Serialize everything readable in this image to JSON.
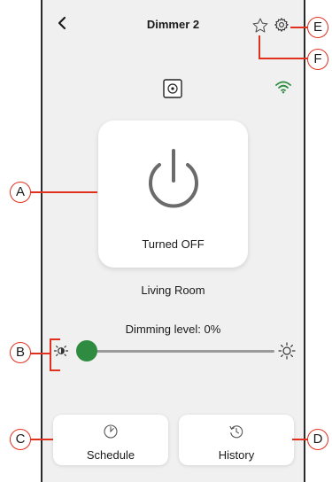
{
  "header": {
    "back_icon": "chevron-left",
    "title": "Dimmer 2",
    "favorite_icon": "star-outline",
    "settings_icon": "gear"
  },
  "device": {
    "icon": "device-module",
    "connection_icon": "wifi",
    "connection_color": "#2e8b3f"
  },
  "power": {
    "icon": "power",
    "status": "Turned OFF"
  },
  "room": "Living Room",
  "dimming": {
    "label": "Dimming level: 0%",
    "level": 0,
    "low_icon": "sun-dim",
    "high_icon": "sun-bright",
    "accent": "#2e8b3f"
  },
  "actions": {
    "schedule": {
      "label": "Schedule",
      "icon": "clock"
    },
    "history": {
      "label": "History",
      "icon": "history-clock"
    }
  },
  "callouts": [
    "A",
    "B",
    "C",
    "D",
    "E",
    "F"
  ]
}
